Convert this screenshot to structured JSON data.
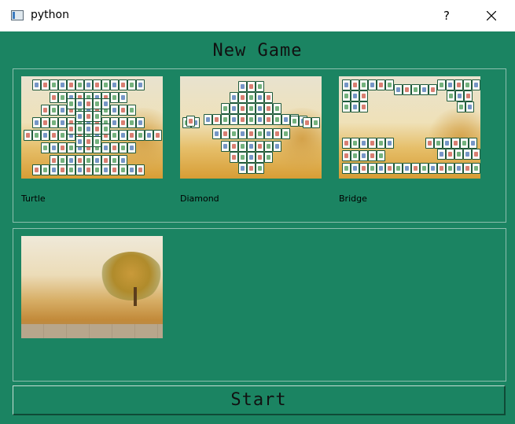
{
  "window": {
    "title": "python",
    "help_label": "?",
    "icons": {
      "app": "app-window-icon",
      "close": "close-icon"
    }
  },
  "heading": "New Game",
  "layouts": [
    {
      "label": "Turtle"
    },
    {
      "label": "Diamond"
    },
    {
      "label": "Bridge"
    }
  ],
  "backgrounds": [
    {
      "name": "autumn-tree-field"
    }
  ],
  "start_label": "Start",
  "colors": {
    "background": "#1b8462",
    "titlebar": "#ffffff",
    "group_border": "#8cbfae"
  }
}
